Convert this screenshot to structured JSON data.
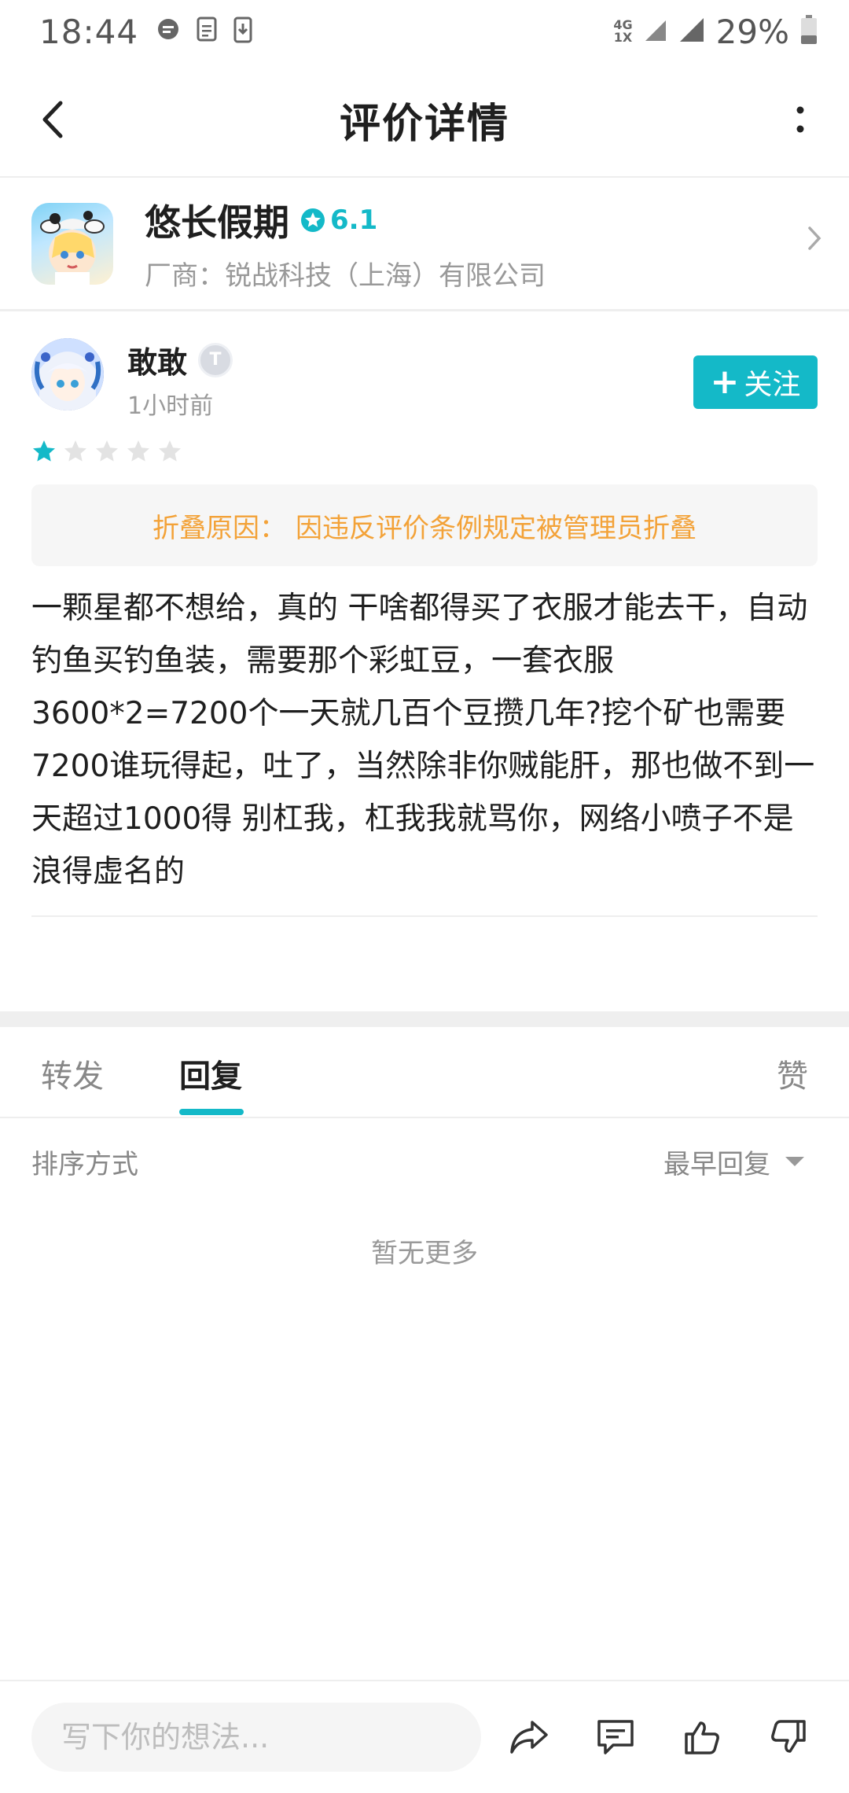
{
  "status_bar": {
    "time": "18:44",
    "network_top": "4G",
    "network_bottom": "1X",
    "battery": "29%"
  },
  "header": {
    "title": "评价详情"
  },
  "app": {
    "name": "悠长假期",
    "rating": "6.1",
    "vendor": "厂商：锐战科技（上海）有限公司"
  },
  "review": {
    "username": "敢敢",
    "level": "T",
    "time": "1小时前",
    "follow_label": "关注",
    "stars": 1,
    "max_stars": 5,
    "fold_label": "折叠原因：",
    "fold_reason": "因违反评价条例规定被管理员折叠",
    "body": "一颗星都不想给，真的 干啥都得买了衣服才能去干，自动钓鱼买钓鱼装，需要那个彩虹豆，一套衣服3600*2=7200个一天就几百个豆攒几年?挖个矿也需要7200谁玩得起，吐了，当然除非你贼能肝，那也做不到一天超过1000得 别杠我，杠我我就骂你，网络小喷子不是浪得虚名的"
  },
  "tabs": {
    "forward": "转发",
    "reply": "回复",
    "like": "赞"
  },
  "sort": {
    "label": "排序方式",
    "value": "最早回复"
  },
  "empty_text": "暂无更多",
  "bottom": {
    "input_placeholder": "写下你的想法..."
  },
  "colors": {
    "accent": "#14b9c8",
    "fold_text": "#f3a238"
  }
}
